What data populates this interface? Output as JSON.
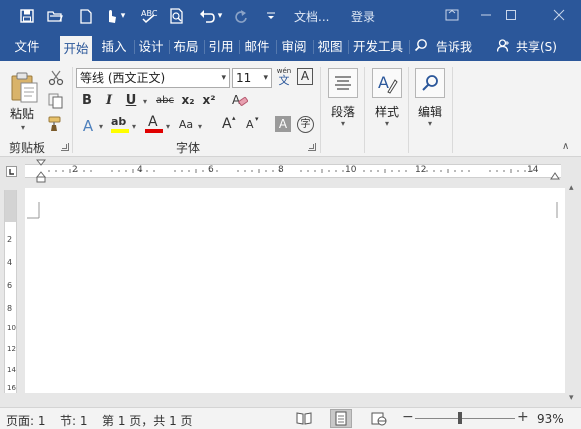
{
  "titlebar": {
    "doc_title": "文档...",
    "login": "登录",
    "qa_icons": [
      "save-icon",
      "open-icon",
      "new-icon",
      "touch-mode-icon",
      "spelling-icon",
      "print-preview-icon",
      "undo-icon",
      "redo-icon",
      "customize-icon"
    ]
  },
  "tabs": [
    {
      "label": "文件",
      "active": false
    },
    {
      "label": "开始",
      "active": true
    },
    {
      "label": "插入",
      "active": false
    },
    {
      "label": "设计",
      "active": false
    },
    {
      "label": "布局",
      "active": false
    },
    {
      "label": "引用",
      "active": false
    },
    {
      "label": "邮件",
      "active": false
    },
    {
      "label": "审阅",
      "active": false
    },
    {
      "label": "视图",
      "active": false
    },
    {
      "label": "开发工具",
      "active": false
    }
  ],
  "tell_me": "告诉我",
  "share": "共享(S)",
  "ribbon": {
    "clipboard": {
      "paste_label": "粘贴",
      "group_label": "剪贴板"
    },
    "font": {
      "font_name": "等线 (西文正文)",
      "font_size": "11",
      "phonetic_top": "wén",
      "phonetic_bottom": "文",
      "char_border": "A",
      "bold": "B",
      "italic": "I",
      "underline": "U",
      "strike": "abc",
      "subscript": "x₂",
      "superscript": "x²",
      "text_effects": "A",
      "highlight": "ab",
      "font_color": "A",
      "change_case": "Aa",
      "grow_font": "A",
      "shrink_font": "A",
      "char_shading": "A",
      "enclose_char": "字",
      "group_label": "字体"
    },
    "paragraph_label": "段落",
    "styles_label": "样式",
    "editing_label": "编辑"
  },
  "ruler_numbers": [
    "2",
    "4",
    "6",
    "8",
    "10",
    "12",
    "14"
  ],
  "vruler_numbers": [
    "2",
    "4",
    "6",
    "8",
    "10",
    "12",
    "14",
    "16"
  ],
  "status": {
    "page": "页面: 1",
    "section": "节: 1",
    "page_of": "第 1 页，共 1 页",
    "zoom": "93%"
  },
  "colors": {
    "brand": "#2b579a",
    "highlight_yellow": "#ffff00",
    "font_red": "#e00000"
  }
}
